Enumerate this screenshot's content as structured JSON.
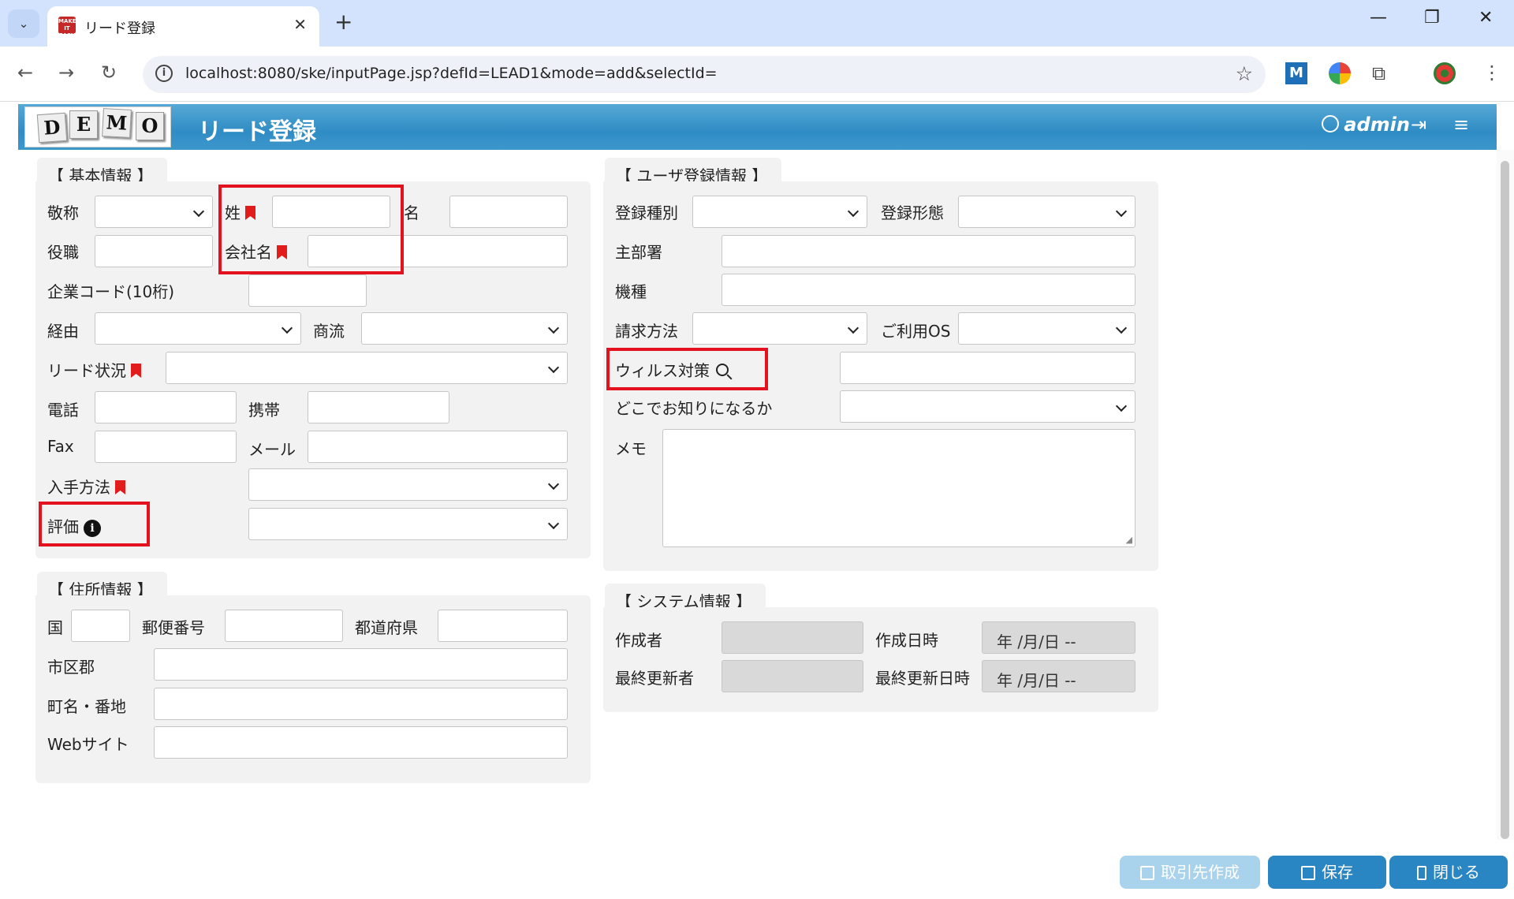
{
  "browser": {
    "tab_title": "リード登録",
    "favicon_text": "MAKE IT EASY",
    "url": "localhost:8080/ske/inputPage.jsp?defId=LEAD1&mode=add&selectId="
  },
  "app": {
    "logo": [
      "D",
      "E",
      "M",
      "O"
    ],
    "title": "リード登録",
    "user": "admin"
  },
  "basic": {
    "title": "【 基本情報 】",
    "honorific": "敬称",
    "last_name": "姓",
    "first_name": "名",
    "position": "役職",
    "company": "会社名",
    "company_code": "企業コード(10桁)",
    "route": "経由",
    "commercial": "商流",
    "lead_status": "リード状況",
    "phone": "電話",
    "mobile": "携帯",
    "fax": "Fax",
    "mail": "メール",
    "acquisition": "入手方法",
    "rating": "評価"
  },
  "address": {
    "title": "【 住所情報 】",
    "country": "国",
    "zip": "郵便番号",
    "prefecture": "都道府県",
    "city": "市区郡",
    "street": "町名・番地",
    "website": "Webサイト"
  },
  "user_reg": {
    "title": "【 ユーザ登録情報 】",
    "reg_type": "登録種別",
    "reg_form": "登録形態",
    "main_dept": "主部署",
    "model": "機種",
    "billing": "請求方法",
    "os": "ご利用OS",
    "antivirus": "ウィルス対策",
    "where_know": "どこでお知りになるか",
    "memo": "メモ"
  },
  "system": {
    "title": "【 システム情報 】",
    "creator": "作成者",
    "created_at": "作成日時",
    "updater": "最終更新者",
    "updated_at": "最終更新日時",
    "date_placeholder": "年 /月/日  --"
  },
  "footer": {
    "create_account": "取引先作成",
    "save": "保存",
    "close": "閉じる"
  }
}
